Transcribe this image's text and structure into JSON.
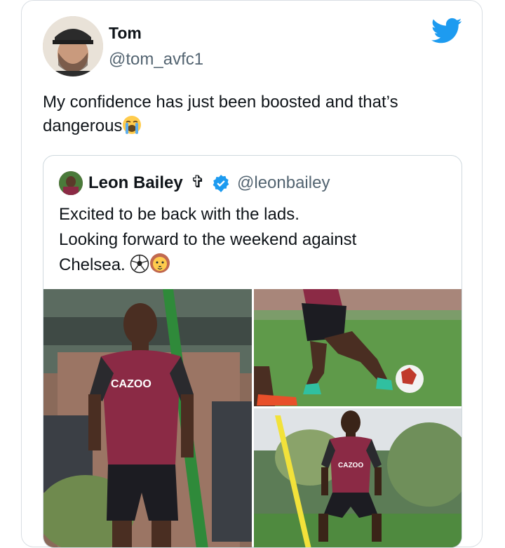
{
  "tweet": {
    "author_name": "Tom",
    "author_handle": "@tom_avfc1",
    "text_line1": "My confidence has just been boosted and that’s",
    "text_line2": "dangerous",
    "emoji": "loudly-crying-face"
  },
  "quoted_tweet": {
    "author_name": "Leon Bailey",
    "name_suffix_symbol": "✞",
    "verified": true,
    "author_handle": "@leonbailey",
    "text_line1": "Excited to be back with the lads.",
    "text_line2": "Looking forward to the weekend against",
    "text_line3": "Chelsea.",
    "emojis": [
      "soccer-ball",
      "lion-face"
    ]
  },
  "media": {
    "photos": [
      {
        "description_name": "player-training-photo-1",
        "shirt_text": "CAZOO"
      },
      {
        "description_name": "ball-dribble-photo"
      },
      {
        "description_name": "player-training-photo-2",
        "shirt_text": "CAZOO"
      }
    ]
  },
  "colors": {
    "twitter_blue": "#1d9bf0",
    "villa_claret": "#8b2a45",
    "text_primary": "#0f1419",
    "text_secondary": "#536471"
  },
  "icons": {
    "logo": "twitter-bird-icon",
    "verified": "verified-badge-icon"
  }
}
